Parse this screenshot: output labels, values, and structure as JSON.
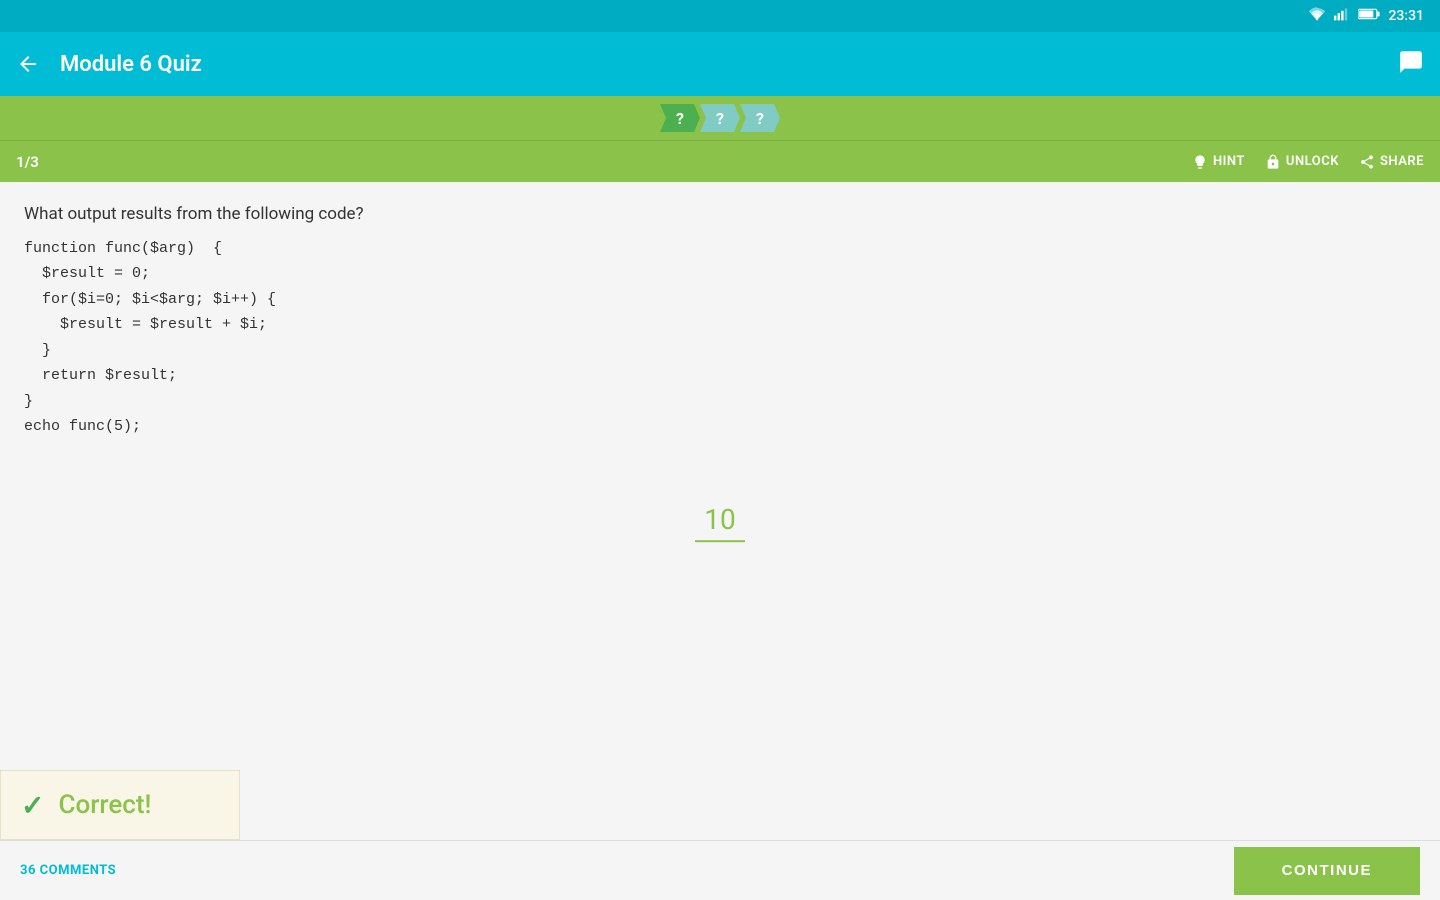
{
  "statusBar": {
    "time": "23:31",
    "wifi": "wifi",
    "signal": "signal",
    "battery": "battery"
  },
  "appBar": {
    "title": "Module 6 Quiz",
    "backIcon": "←",
    "chatIcon": "💬"
  },
  "progressSteps": [
    {
      "label": "?",
      "state": "active"
    },
    {
      "label": "?",
      "state": "inactive"
    },
    {
      "label": "?",
      "state": "inactive"
    }
  ],
  "quizToolbar": {
    "counter": "1/3",
    "hintLabel": "HINT",
    "unlockLabel": "UNLOCK",
    "shareLabel": "SHARE"
  },
  "question": {
    "prompt": "What output results from the following code?",
    "code": "function func($arg)  {\n  $result = 0;\n  for($i=0; $i<$arg; $i++) {\n    $result = $result + $i;\n  }\n  return $result;\n}\necho func(5);"
  },
  "answer": {
    "value": "10"
  },
  "correctBanner": {
    "checkmark": "✓",
    "text": "Correct!"
  },
  "bottomBar": {
    "commentsLabel": "36 COMMENTS",
    "continueLabel": "CONTINUE"
  }
}
